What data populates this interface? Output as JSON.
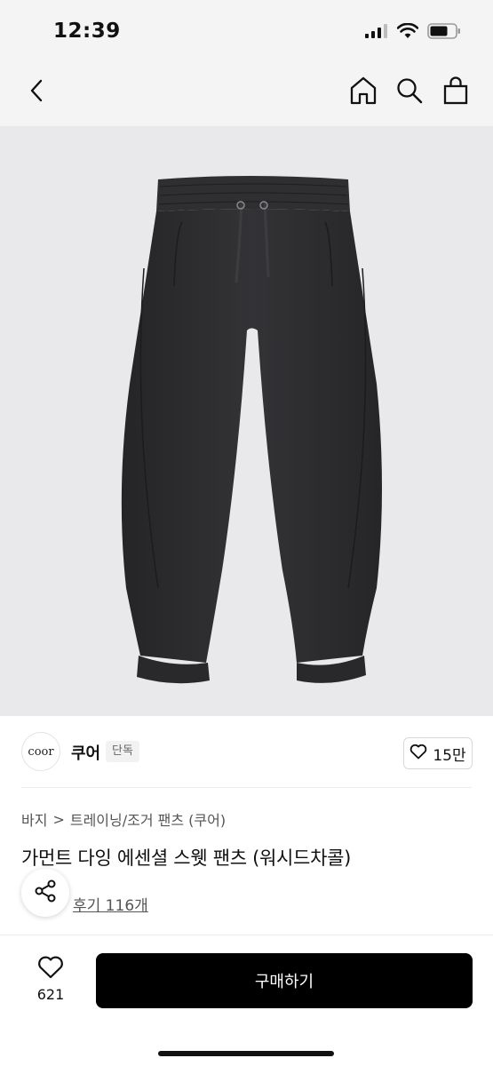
{
  "status": {
    "time": "12:39",
    "icons": [
      "signal-icon",
      "wifi-icon",
      "battery-icon"
    ]
  },
  "nav": {
    "icons": [
      "back-icon",
      "home-icon",
      "search-icon",
      "shopping-bag-icon"
    ]
  },
  "brand": {
    "logo_text": "coor",
    "name": "쿠어",
    "badge": "단독",
    "likes": "15만"
  },
  "breadcrumb": {
    "category": "바지",
    "separator": ">",
    "subcategory": "트레이닝/조거 팬츠 (쿠어)"
  },
  "product": {
    "title": "가먼트 다잉 에센셜 스웻 팬츠 (워시드차콜)",
    "review_link": "후기 116개",
    "image_color": "#2b2b2d"
  },
  "bottom": {
    "wish_count": "621",
    "buy_label": "구매하기"
  },
  "colors": {
    "header_bg": "#f4f4f4",
    "image_bg": "#e9e9eb",
    "buy_bg": "#000000",
    "text": "#111111"
  }
}
